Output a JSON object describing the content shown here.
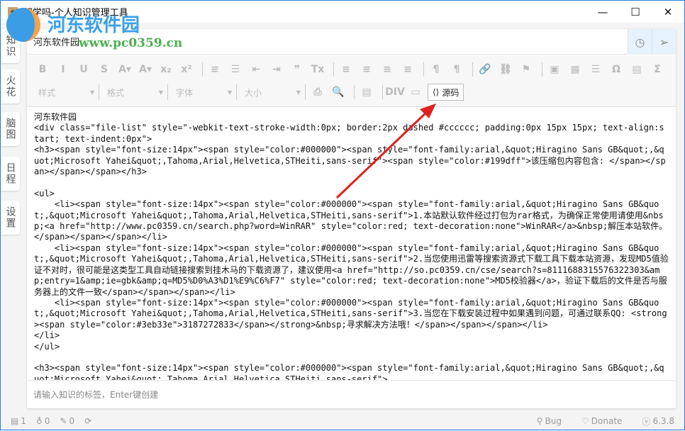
{
  "window": {
    "title": "想学吗-个人知识管理工具",
    "minimize": "—",
    "maximize": "☐",
    "close": "✕"
  },
  "watermark": {
    "name": "河东软件园",
    "url": "www.pc0359.cn"
  },
  "sidebar": {
    "tabs": [
      {
        "label": "知识"
      },
      {
        "label": "火花"
      },
      {
        "label": "脑图"
      },
      {
        "label": "日程"
      },
      {
        "label": "设置"
      }
    ]
  },
  "editor": {
    "title_value": "河东软件园",
    "toolbar_row1": [
      "B",
      "I",
      "U",
      "S",
      "A▾",
      "A▾",
      "x₂",
      "x²",
      "|",
      "≡",
      "☰",
      "⇤",
      "⇥",
      "❞",
      "Tx",
      "|",
      "≡",
      "≡",
      "≡",
      "≡",
      "|",
      "¶",
      "¶",
      "|",
      "🔗",
      "⛓",
      "⚑",
      "|",
      "▣",
      "▦",
      "☰",
      "Ω",
      "▤",
      "Σ"
    ],
    "combos": [
      {
        "label": "样式"
      },
      {
        "label": "格式"
      },
      {
        "label": "字体"
      },
      {
        "label": "大小"
      }
    ],
    "toolbar_row2": [
      "⎙",
      "🔍",
      "|",
      "▤",
      "|",
      "DIV",
      "▭"
    ],
    "source_button": "源码",
    "content": "河东软件园\n<div class=\"file-list\" style=\"-webkit-text-stroke-width:0px; border:2px dashed #cccccc; padding:0px 15px 15px; text-align:start; text-indent:0px\">\n<h3><span style=\"font-size:14px\"><span style=\"color:#000000\"><span style=\"font-family:arial,&quot;Hiragino Sans GB&quot;,&quot;Microsoft Yahei&quot;,Tahoma,Arial,Helvetica,STHeiti,sans-serif\"><span style=\"color:#199dff\">该压缩包内容包含: </span></span></span></span></h3>\n\n<ul>\n    <li><span style=\"font-size:14px\"><span style=\"color:#000000\"><span style=\"font-family:arial,&quot;Hiragino Sans GB&quot;,&quot;Microsoft Yahei&quot;,Tahoma,Arial,Helvetica,STHeiti,sans-serif\">1.本站默认软件经过打包为rar格式，为确保正常使用请使用&nbsp;<a href=\"http://www.pc0359.cn/search.php?word=WinRAR\" style=\"color:red; text-decoration:none\">WinRAR</a>&nbsp;解压本站软件。</span></span></span></li>\n    <li><span style=\"font-size:14px\"><span style=\"color:#000000\"><span style=\"font-family:arial,&quot;Hiragino Sans GB&quot;,&quot;Microsoft Yahei&quot;,Tahoma,Arial,Helvetica,STHeiti,sans-serif\">2.当您使用迅雷等搜索资源式下载工具下载本站资源，发现MD5值验证不对时，很可能是这类型工具自动链接搜索到挂木马的下载资源了，建议使用<a href=\"http://so.pc0359.cn/cse/search?s=8111688315576322303&amp;entry=1&amp;ie=gbk&amp;q=MD5%D0%A3%D1%E9%C6%F7\" style=\"color:red; text-decoration:none\">MD5校验器</a>，验证下载后的文件是否与服务器上的文件一致</span></span></span></li>\n    <li><span style=\"font-size:14px\"><span style=\"color:#000000\"><span style=\"font-family:arial,&quot;Hiragino Sans GB&quot;,&quot;Microsoft Yahei&quot;,Tahoma,Arial,Helvetica,STHeiti,sans-serif\">3.当您在下载安装过程中如果遇到问题，可通过联系QQ: <strong><span style=\"color:#3eb33e\">3187272833</span></strong>&nbsp;寻求解决方法哦！</span></span></span></li>\n</li>\n</ul>\n\n<h3><span style=\"font-size:14px\"><span style=\"color:#000000\"><span style=\"font-family:arial,&quot;Hiragino Sans GB&quot;,&quot;Microsoft Yahei&quot;,Tahoma,Arial,Helvetica,STHeiti,sans-serif\">",
    "tag_placeholder": "请输入知识的标签，Enter键创建"
  },
  "status": {
    "docs": "1",
    "likes": "0",
    "edits": "0",
    "bug": "Bug",
    "donate": "Donate",
    "version": "6.3.8"
  },
  "colors": {
    "accent": "#2b7fd6",
    "arrow": "#e02020",
    "toolbar_bg": "#f7f7f7"
  }
}
